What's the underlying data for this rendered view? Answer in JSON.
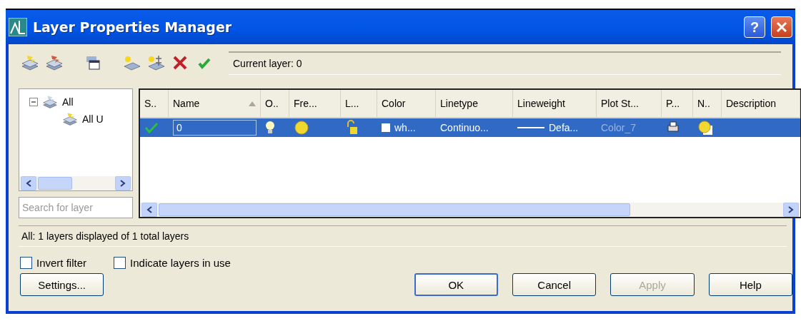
{
  "window": {
    "title": "Layer Properties Manager",
    "controls": [
      {
        "kind": "help",
        "label": "?"
      },
      {
        "kind": "close"
      }
    ]
  },
  "toolbar": {
    "current_layer": "Current layer: 0"
  },
  "tree": {
    "items": [
      {
        "label": "All",
        "expanded": true,
        "children": [
          {
            "label": "All U"
          }
        ]
      }
    ]
  },
  "search": {
    "placeholder": "Search for layer"
  },
  "table": {
    "columns": [
      {
        "label": "S..",
        "sorted": false
      },
      {
        "label": "Name",
        "sorted": true
      },
      {
        "label": "O..",
        "sorted": false
      },
      {
        "label": "Fre...",
        "sorted": false
      },
      {
        "label": "L...",
        "sorted": false
      },
      {
        "label": "Color",
        "sorted": false
      },
      {
        "label": "Linetype",
        "sorted": false
      },
      {
        "label": "Lineweight",
        "sorted": false
      },
      {
        "label": "Plot St...",
        "sorted": false
      },
      {
        "label": "P...",
        "sorted": false
      },
      {
        "label": "N..",
        "sorted": false
      },
      {
        "label": "Description",
        "sorted": false
      }
    ],
    "rows": [
      {
        "selected": true,
        "current": true,
        "name": "0",
        "color": "#ffffff",
        "color_label": "wh...",
        "linetype": "Continuo...",
        "lineweight": "Defa...",
        "plot_style": "Color_7",
        "plot_style_disabled": true
      }
    ]
  },
  "status_bar": "All: 1 layers displayed of 1 total layers",
  "options": [
    {
      "label": "Invert filter",
      "checked": false
    },
    {
      "label": "Indicate layers in use",
      "checked": false
    }
  ],
  "buttons": [
    {
      "label": "Settings...",
      "disabled": false,
      "default": false
    },
    {
      "label": "OK",
      "disabled": false,
      "default": true
    },
    {
      "label": "Cancel",
      "disabled": false,
      "default": false
    },
    {
      "label": "Apply",
      "disabled": true,
      "default": false
    },
    {
      "label": "Help",
      "disabled": false,
      "default": false
    }
  ]
}
